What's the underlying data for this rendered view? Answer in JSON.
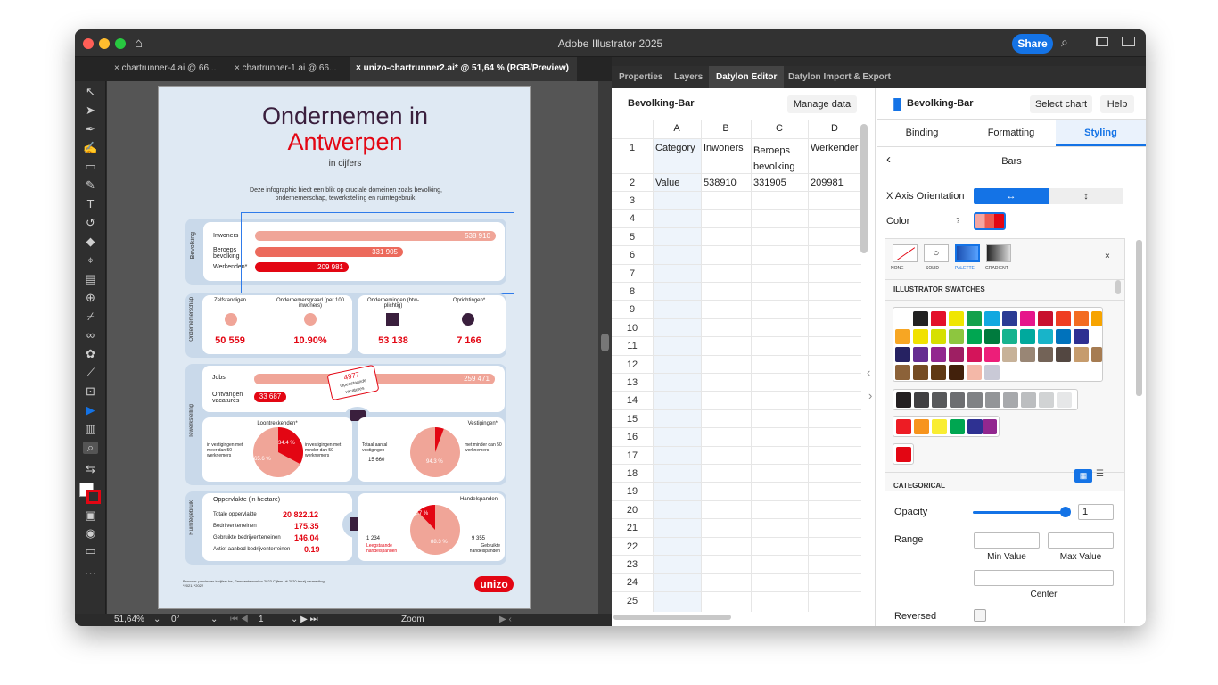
{
  "window": {
    "title": "Adobe Illustrator 2025",
    "share_label": "Share"
  },
  "doc_tabs": [
    {
      "label": "chartrunner-4.ai @ 66..."
    },
    {
      "label": "chartrunner-1.ai @ 66..."
    },
    {
      "label": "unizo-chartrunner2.ai* @ 51,64 % (RGB/Preview)"
    }
  ],
  "panel_tabs": [
    "Properties",
    "Layers",
    "Datylon Editor",
    "Datylon Import & Export"
  ],
  "sheet": {
    "title": "Bevolking-Bar",
    "manage_label": "Manage data",
    "columns": [
      "A",
      "B",
      "C",
      "D"
    ],
    "header_row": [
      "Category",
      "Inwoners",
      "Beroeps bevolking",
      "Werkender"
    ],
    "value_row": [
      "Value",
      "538910",
      "331905",
      "209981"
    ],
    "row_numbers": [
      "1",
      "2",
      "3",
      "4",
      "5",
      "6",
      "7",
      "8",
      "9",
      "10",
      "11",
      "12",
      "13",
      "14",
      "15",
      "16",
      "17",
      "18",
      "19",
      "20",
      "21",
      "22",
      "23",
      "24",
      "25"
    ]
  },
  "styling": {
    "chart_name": "Bevolking-Bar",
    "select_chart": "Select chart",
    "help": "Help",
    "tabs": [
      "Binding",
      "Formatting",
      "Styling"
    ],
    "section": "Bars",
    "x_axis_label": "X Axis Orientation",
    "color_label": "Color",
    "color_help": "?",
    "fill_modes": [
      "NONE",
      "SOLID",
      "PALETTE",
      "GRADIENT"
    ],
    "swatches_title": "ILLUSTRATOR SWATCHES",
    "categorical_label": "CATEGORICAL",
    "opacity_label": "Opacity",
    "opacity_value": "1",
    "range_label": "Range",
    "min_label": "Min Value",
    "max_label": "Max Value",
    "center_label": "Center",
    "reversed_label": "Reversed"
  },
  "status": {
    "zoom": "51,64%",
    "rotation": "0°",
    "page": "1",
    "mode": "Zoom"
  },
  "artboard": {
    "title1": "Ondernemen in",
    "title2": "Antwerpen",
    "subtitle": "in cijfers",
    "intro": "Deze infographic biedt een blik op cruciale domeinen zoals bevolking, ondernemerschap, tewerkstelling en ruimtegebruik.",
    "bevolking": {
      "label": "Bevolking",
      "rows": [
        {
          "name": "Inwoners",
          "value": "538 910",
          "frac": 1.0
        },
        {
          "name": "Beroeps bevolking",
          "value": "331 905",
          "frac": 0.616
        },
        {
          "name": "Werkenden*",
          "value": "209 981",
          "frac": 0.39
        }
      ]
    },
    "onder": {
      "label": "Ondernemerschap",
      "items": [
        {
          "name": "Zelfstandigen",
          "value": "50 559"
        },
        {
          "name": "Ondernemersgraad (per 100 inwoners)",
          "value": "10.90%"
        },
        {
          "name": "Ondernemingen (btw-plichtig)",
          "value": "53 138"
        },
        {
          "name": "Oprichtingen*",
          "value": "7 166"
        }
      ]
    },
    "tewerk": {
      "label": "Tewerkstelling",
      "jobs": "Jobs",
      "jobs_value": "259 471",
      "vac": "Ontvangen vacatures",
      "vac_value": "33 687",
      "tag_value": "4977",
      "tag_text": "Openstaande vacatures",
      "left_title": "Loontrekkenden*",
      "left_a": "in vestigingen met meer dan 50 werknemers",
      "left_b": "in vestigingen met minder dan 50 werknemers",
      "pie1_a": "34.4 %",
      "pie1_b": "65.6 %",
      "right_title": "Vestigingen*",
      "total_label": "Totaal aantal vestigingen",
      "total_value": "15 660",
      "right_b": "met minder dan 50 werknemers",
      "pie2": "94.3 %"
    },
    "ruimte": {
      "label": "Ruimtegebruik",
      "opp": "Oppervlakte (in hectare)",
      "rows": [
        {
          "name": "Totale oppervlakte",
          "value": "20 822.12"
        },
        {
          "name": "Bedrijventerreinen",
          "value": "175.35"
        },
        {
          "name": "Gebruikte bedrijventerreinen",
          "value": "146.04"
        },
        {
          "name": "Actief aanbod bedrijventerreinen",
          "value": "0.19"
        }
      ],
      "handels": "Handelspanden",
      "pie_a": "11.7 %",
      "pie_b": "88.3 %",
      "left_num": "1 234",
      "left_txt": "Leegstaande handelspanden",
      "right_num": "9 355",
      "right_txt": "Gebruikte handelspanden"
    },
    "sources": "Bronnen: provincies.incijfers.be, Gemeentemonitor 2023 Cijfers uit 2020 tenzij vermelding: *2021, *2022",
    "logo": "unizo"
  },
  "colors": {
    "accent": "#e30613",
    "brand_dark": "#3a1f3d",
    "blue": "#1473e6",
    "light_red": "#f0a598"
  }
}
